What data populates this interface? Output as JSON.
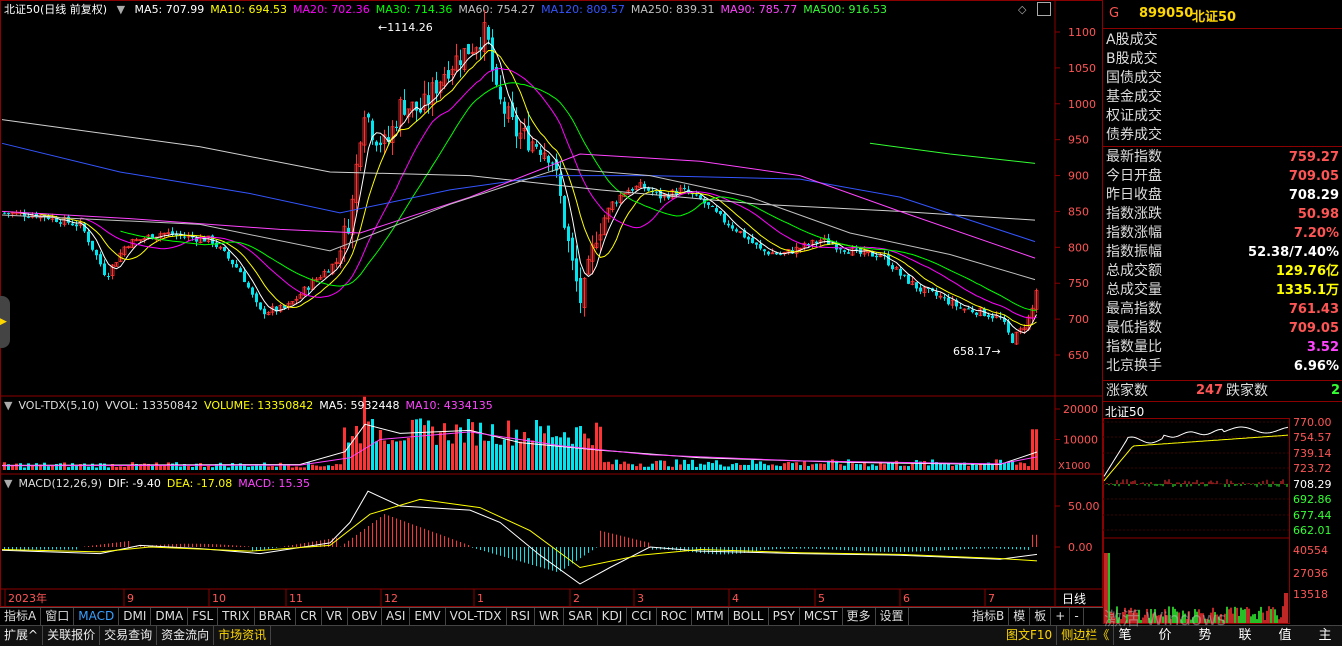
{
  "main": {
    "title": "北证50(日线 前复权)",
    "ma": [
      {
        "label": "MA5: 707.99",
        "color": "#ffffff"
      },
      {
        "label": "MA10: 694.53",
        "color": "#ffff00"
      },
      {
        "label": "MA20: 702.36",
        "color": "#ff00ff"
      },
      {
        "label": "MA30: 714.36",
        "color": "#00ff00"
      },
      {
        "label": "MA60: 754.27",
        "color": "#c0c0c0"
      },
      {
        "label": "MA120: 809.57",
        "color": "#3355ff"
      },
      {
        "label": "MA250: 839.31",
        "color": "#c0c0c0"
      },
      {
        "label": "MA90: 785.77",
        "color": "#ff44ff"
      },
      {
        "label": "MA500: 916.53",
        "color": "#33ff33"
      }
    ],
    "y_ticks": [
      "1100",
      "1050",
      "1000",
      "950",
      "900",
      "850",
      "800",
      "750",
      "700",
      "650"
    ],
    "high_label": "1114.26",
    "low_label": "658.17"
  },
  "volume": {
    "legend": [
      {
        "label": "VOL-TDX(5,10)",
        "color": "#dddddd"
      },
      {
        "label": "VVOL: 13350842",
        "color": "#dddddd"
      },
      {
        "label": "VOLUME: 13350842",
        "color": "#ffff00"
      },
      {
        "label": "MA5: 5932448",
        "color": "#ffffff"
      },
      {
        "label": "MA10: 4334135",
        "color": "#ff44ff"
      }
    ],
    "y_ticks": [
      "20000",
      "10000"
    ],
    "unit": "X1000"
  },
  "macd": {
    "legend": [
      {
        "label": "MACD(12,26,9)",
        "color": "#dddddd"
      },
      {
        "label": "DIF: -9.40",
        "color": "#ffffff"
      },
      {
        "label": "DEA: -17.08",
        "color": "#ffff00"
      },
      {
        "label": "MACD: 15.35",
        "color": "#ff44ff"
      }
    ],
    "y_ticks": [
      "50.00",
      "0.00"
    ]
  },
  "x_labels": [
    "2023年",
    "9",
    "10",
    "11",
    "12",
    "1",
    "2",
    "3",
    "4",
    "5",
    "6",
    "7"
  ],
  "x_period": "日线",
  "tabs": [
    "指标A",
    "窗口",
    "MACD",
    "DMI",
    "DMA",
    "FSL",
    "TRIX",
    "BRAR",
    "CR",
    "VR",
    "OBV",
    "ASI",
    "EMV",
    "VOL-TDX",
    "RSI",
    "WR",
    "SAR",
    "KDJ",
    "CCI",
    "ROC",
    "MTM",
    "BOLL",
    "PSY",
    "MCST",
    "更多",
    "设置"
  ],
  "tabs_right": [
    "指标B",
    "模",
    "板",
    "+",
    "-"
  ],
  "status_left": [
    "扩展^",
    "关联报价",
    "交易查询",
    "资金流向",
    "市场资讯"
  ],
  "status_right": [
    "图文F10",
    "侧边栏《"
  ],
  "watermark": "激活 Windows",
  "right_btns": [
    "笔",
    "价",
    "势",
    "联",
    "值",
    "主"
  ],
  "quote": {
    "flag": "G",
    "code": "899050",
    "name": "北证50",
    "sub_items": [
      "A股成交",
      "B股成交",
      "国债成交",
      "基金成交",
      "权证成交",
      "债券成交"
    ],
    "rows": [
      {
        "label": "最新指数",
        "value": "759.27",
        "color": "#ff5555"
      },
      {
        "label": "今日开盘",
        "value": "709.05",
        "color": "#ff5555"
      },
      {
        "label": "昨日收盘",
        "value": "708.29",
        "color": "#ffffff"
      },
      {
        "label": "指数涨跌",
        "value": "50.98",
        "color": "#ff5555"
      },
      {
        "label": "指数涨幅",
        "value": "7.20%",
        "color": "#ff5555"
      },
      {
        "label": "指数振幅",
        "value": "52.38/7.40%",
        "color": "#ffffff"
      },
      {
        "label": "总成交额",
        "value": "129.76亿",
        "color": "#ffff00"
      },
      {
        "label": "总成交量",
        "value": "1335.1万",
        "color": "#ffff00"
      },
      {
        "label": "最高指数",
        "value": "761.43",
        "color": "#ff5555"
      },
      {
        "label": "最低指数",
        "value": "709.05",
        "color": "#ff5555"
      },
      {
        "label": "指数量比",
        "value": "3.52",
        "color": "#ff44ff"
      },
      {
        "label": "北京换手",
        "value": "6.96%",
        "color": "#ffffff"
      }
    ],
    "up_label": "涨家数",
    "up_count": "247",
    "down_label": "跌家数",
    "down_count": "2"
  },
  "mini": {
    "title": "北证50",
    "price_ticks": [
      "770.00",
      "754.57",
      "739.14",
      "723.72",
      "708.29",
      "692.86",
      "677.44",
      "662.01"
    ],
    "vol_ticks": [
      "40554",
      "27036",
      "13518"
    ]
  },
  "colors": {
    "up": "#ff3333",
    "down": "#00e5ee",
    "frame": "#8b0000"
  }
}
